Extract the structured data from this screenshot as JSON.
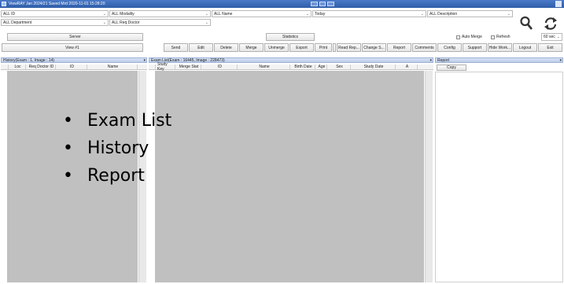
{
  "window": {
    "title": "ViewRAY  Jan 2024/21  Saved Mrd 2020-11-01 15:28:20"
  },
  "filters": {
    "row1": {
      "patient": "ALL ID",
      "modality": "ALL Modality",
      "name": "ALL Name",
      "date": "Today",
      "description": "ALL Description"
    },
    "row2": {
      "department": "ALL Department",
      "req_doctor": "ALL Req.Doctor"
    }
  },
  "toolbar": {
    "server_label": "Server",
    "statistics_label": "Statistics",
    "view_label": "View #1",
    "auto_merge_label": "Auto Merge",
    "refresh_label": "Refresh",
    "interval_value": "60 sec",
    "buttons": [
      "Send",
      "Edit",
      "Delete",
      "Merge",
      "Unmerge",
      "Export",
      "Print",
      "Read Rep...",
      "Change S...",
      "Report",
      "Comments",
      "Config",
      "Support",
      "Hide Work...",
      "Logout",
      "Exit"
    ]
  },
  "left_panel": {
    "header": "History(Exam : 1, Image : 14)",
    "columns": [
      "Loc",
      "Req Doctor ID",
      "ID",
      "Name"
    ]
  },
  "center_panel": {
    "header": "Exam List(Exam : 16445, Image : 228473)",
    "columns": [
      "Study Key",
      "Merge Stat",
      "ID",
      "Name",
      "Birth Date",
      "Age",
      "Sex",
      "Study Date",
      "A"
    ]
  },
  "right_panel": {
    "header": "Report",
    "copy_label": "Copy"
  },
  "overlay": {
    "items": [
      "Exam List",
      "History",
      "Report"
    ]
  },
  "icons": {
    "search": "search-icon",
    "refresh": "refresh-icon"
  }
}
